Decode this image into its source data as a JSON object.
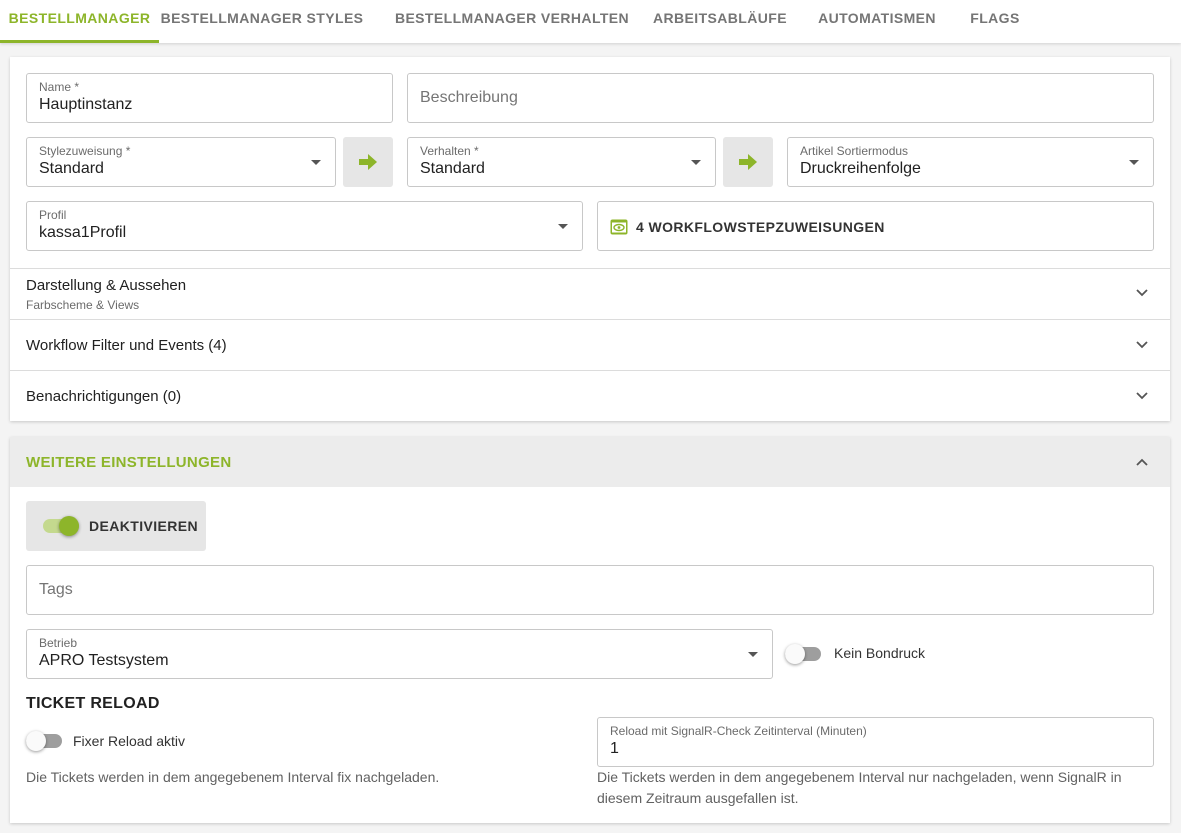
{
  "tabs": [
    {
      "label": "BESTELLMANAGER",
      "active": true
    },
    {
      "label": "BESTELLMANAGER STYLES",
      "active": false
    },
    {
      "label": "BESTELLMANAGER VERHALTEN",
      "active": false
    },
    {
      "label": "ARBEITSABLÄUFE",
      "active": false
    },
    {
      "label": "AUTOMATISMEN",
      "active": false
    },
    {
      "label": "FLAGS",
      "active": false
    }
  ],
  "form": {
    "name": {
      "label": "Name *",
      "value": "Hauptinstanz"
    },
    "beschreibung": {
      "placeholder": "Beschreibung"
    },
    "style": {
      "label": "Stylezuweisung *",
      "value": "Standard"
    },
    "verhalten": {
      "label": "Verhalten *",
      "value": "Standard"
    },
    "sortier": {
      "label": "Artikel Sortiermodus",
      "value": "Druckreihenfolge"
    },
    "profil": {
      "label": "Profil",
      "value": "kassa1Profil"
    },
    "workflow_button": "4 WORKFLOWSTEPZUWEISUNGEN"
  },
  "panels": {
    "darstellung": {
      "title": "Darstellung & Aussehen",
      "subtitle": "Farbscheme & Views"
    },
    "workflow": {
      "title": "Workflow Filter und Events (4)"
    },
    "benachrichtigungen": {
      "title": "Benachrichtigungen (0)"
    }
  },
  "weitere": {
    "title": "WEITERE EINSTELLUNGEN",
    "deaktivieren_label": "DEAKTIVIEREN",
    "deaktivieren_on": true,
    "tags_placeholder": "Tags",
    "betrieb": {
      "label": "Betrieb",
      "value": "APRO Testsystem"
    },
    "kein_bondruck": {
      "label": "Kein Bondruck",
      "on": false
    },
    "ticket_reload": {
      "title": "TICKET RELOAD",
      "fixer": {
        "label": "Fixer Reload aktiv",
        "on": false
      },
      "fixer_hint": "Die Tickets werden in dem angegebenem Interval fix nachgeladen.",
      "signalr": {
        "label": "Reload mit SignalR-Check Zeitinterval (Minuten)",
        "value": "1"
      },
      "signalr_hint_line1": "Die Tickets werden in dem angegebenem Interval nur nachgeladen, wenn SignalR in",
      "signalr_hint_line2": "diesem Zeitraum ausgefallen ist."
    }
  },
  "colors": {
    "accent": "#8db52a",
    "accent_light": "#c4d98e"
  },
  "icons": [
    "arrow-right-icon",
    "eye-icon",
    "chevron-down-icon",
    "chevron-up-icon"
  ]
}
